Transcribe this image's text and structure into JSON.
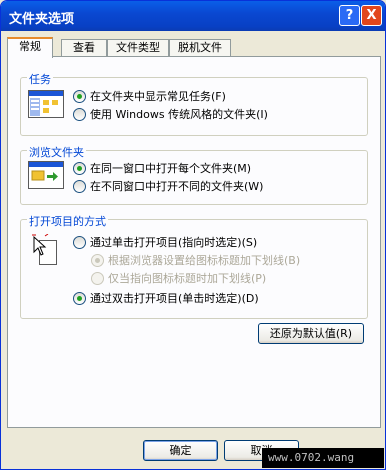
{
  "window": {
    "title": "文件夹选项",
    "help_label": "?",
    "close_label": "X"
  },
  "tabs": [
    {
      "label": "常规"
    },
    {
      "label": "查看"
    },
    {
      "label": "文件类型"
    },
    {
      "label": "脱机文件"
    }
  ],
  "tasks": {
    "label": "任务",
    "options": [
      {
        "label": "在文件夹中显示常见任务(F)",
        "selected": true
      },
      {
        "label": "使用 Windows 传统风格的文件夹(I)",
        "selected": false
      }
    ]
  },
  "browse": {
    "label": "浏览文件夹",
    "options": [
      {
        "label": "在同一窗口中打开每个文件夹(M)",
        "selected": true
      },
      {
        "label": "在不同窗口中打开不同的文件夹(W)",
        "selected": false
      }
    ]
  },
  "click": {
    "label": "打开项目的方式",
    "options": [
      {
        "label": "通过单击打开项目(指向时选定)(S)",
        "selected": false
      },
      {
        "label": "根据浏览器设置给图标标题加下划线(B)",
        "selected": true,
        "disabled": true
      },
      {
        "label": "仅当指向图标标题时加下划线(P)",
        "selected": false,
        "disabled": true
      },
      {
        "label": "通过双击打开项目(单击时选定)(D)",
        "selected": true
      }
    ]
  },
  "restore_label": "还原为默认值(R)",
  "ok_label": "确定",
  "cancel_label": "取消",
  "watermark": "www.0702.wang"
}
